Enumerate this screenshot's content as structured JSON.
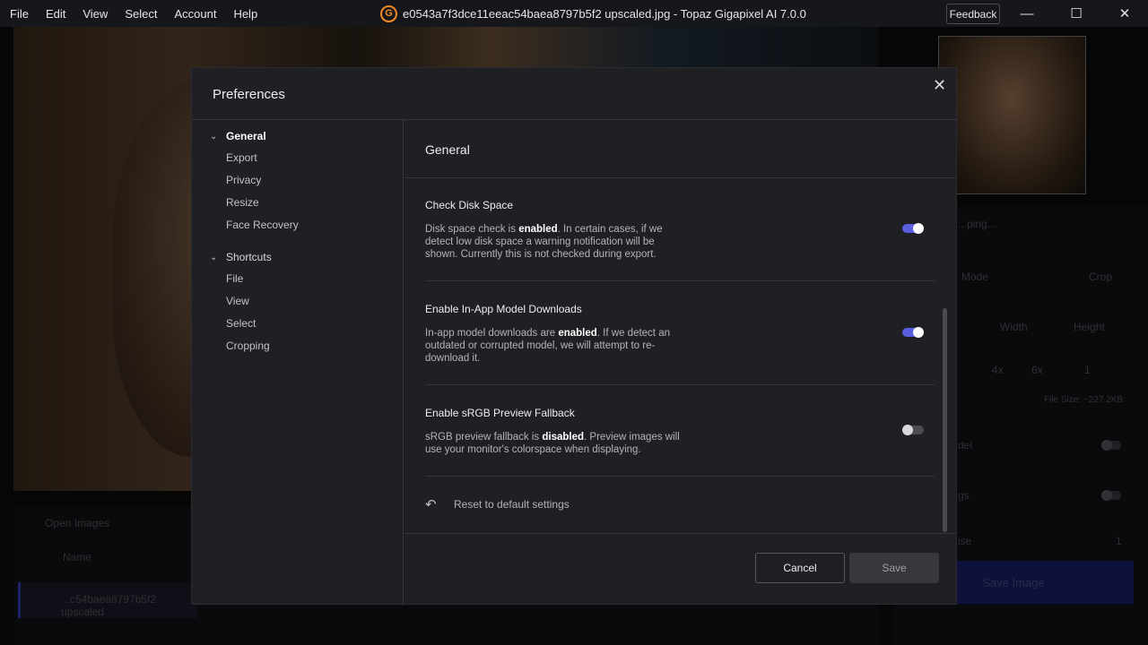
{
  "titlebar": {
    "menu": [
      "File",
      "Edit",
      "View",
      "Select",
      "Account",
      "Help"
    ],
    "logo_letter": "G",
    "window_title": "e0543a7f3dce11eeac54baea8797b5f2 upscaled.jpg - Topaz Gigapixel AI 7.0.0",
    "feedback_label": "Feedback",
    "minimize": "—",
    "maximize": "☐",
    "close": "✕"
  },
  "background": {
    "open_images": "Open Images",
    "name_col": "Name",
    "file_row": "...c54baea8797b5f2 upscaled",
    "processing": "...ping...",
    "mode": "Mode",
    "crop": "Crop",
    "width": "Width",
    "height": "Height",
    "scale_4x": "4x",
    "scale_6x": "6x",
    "scale_value": "1",
    "file_size": "File Size: ~227.2KB",
    "model": "del",
    "settings": "gs",
    "noise": "ise",
    "noise_value": "1",
    "save_image": "Save Image"
  },
  "modal": {
    "title": "Preferences",
    "close": "✕",
    "sidebar": {
      "general": "General",
      "general_items": [
        "Export",
        "Privacy",
        "Resize",
        "Face Recovery"
      ],
      "shortcuts": "Shortcuts",
      "shortcuts_items": [
        "File",
        "View",
        "Select",
        "Cropping"
      ]
    },
    "content_title": "General",
    "settings": [
      {
        "title": "Check Disk Space",
        "desc_pre": "Disk space check is ",
        "desc_bold": "enabled",
        "desc_post": ". In certain cases, if we detect low disk space a warning notification will be shown. Currently this is not checked during export.",
        "enabled": true
      },
      {
        "title": "Enable In-App Model Downloads",
        "desc_pre": "In-app model downloads are ",
        "desc_bold": "enabled",
        "desc_post": ". If we detect an outdated or corrupted model, we will attempt to re-download it.",
        "enabled": true
      },
      {
        "title": "Enable sRGB Preview Fallback",
        "desc_pre": "sRGB preview fallback is ",
        "desc_bold": "disabled",
        "desc_post": ". Preview images will use your monitor's colorspace when displaying.",
        "enabled": false
      }
    ],
    "reset_label": "Reset to default settings",
    "cancel_label": "Cancel",
    "save_label": "Save"
  }
}
